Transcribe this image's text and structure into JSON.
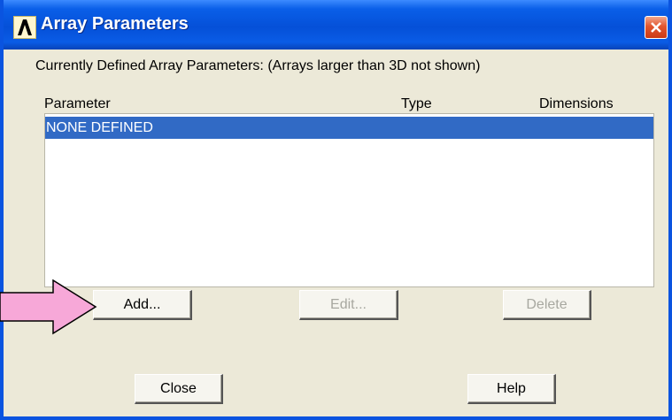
{
  "window": {
    "title": "Array Parameters"
  },
  "prompt": "Currently Defined Array Parameters: (Arrays larger than 3D not shown)",
  "table": {
    "columns": [
      "Parameter",
      "Type",
      "Dimensions"
    ],
    "rows": [
      {
        "parameter": "NONE DEFINED",
        "selected": true
      }
    ]
  },
  "buttons": {
    "add": "Add...",
    "edit": "Edit...",
    "delete": "Delete",
    "close": "Close",
    "help": "Help"
  },
  "colors": {
    "titlebar": "#0550d8",
    "selection": "#316ac5",
    "dialog_bg": "#ece9d8",
    "close_button": "#e2552e",
    "pointer_arrow": "#f7a8d8"
  }
}
